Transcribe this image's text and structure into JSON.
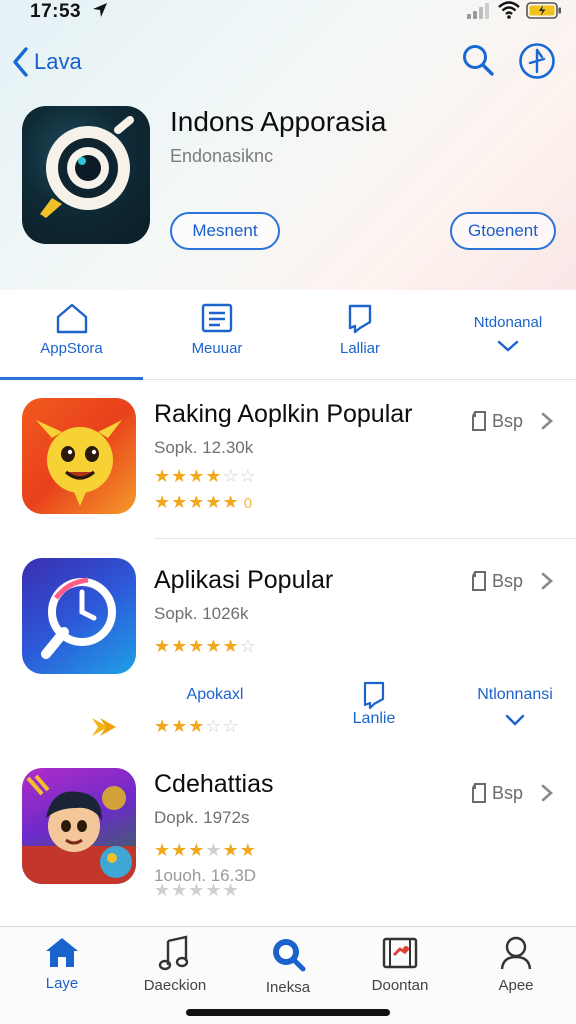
{
  "status_bar": {
    "time": "17:53"
  },
  "nav": {
    "back_label": "Lava"
  },
  "app": {
    "title": "Indons Apporasia",
    "subtitle": "Endonasiknc",
    "btn_left": "Mesnent",
    "btn_right": "Gtoenent"
  },
  "tabs": [
    {
      "label": "AppStora",
      "icon": "house-icon"
    },
    {
      "label": "Meuuar",
      "icon": "list-icon"
    },
    {
      "label": "Lalliar",
      "icon": "bookmark-icon"
    },
    {
      "label": "Ntdonanal",
      "icon": "chevron-down-icon"
    }
  ],
  "rows": [
    {
      "title": "Raking Aoplkin Popular",
      "meta": "Sopk. 12.30k",
      "rating": 3.5,
      "rating2": 5,
      "rating2_suffix": "0",
      "get_label": "Bsp"
    },
    {
      "title": "Aplikasi Popular",
      "meta": "Sopk. 1026k",
      "rating": 4.5,
      "get_label": "Bsp"
    },
    {
      "title": "Cdehattias",
      "meta": "Dopk. 1972s",
      "rating": 4,
      "meta2": "1ouoh. 16.3D",
      "get_label": "Bsp"
    }
  ],
  "subtabs": [
    {
      "label": "Apokaxl"
    },
    {
      "label": "Lanlie"
    },
    {
      "label": "Ntlonnansi"
    }
  ],
  "sub_rating": 3,
  "tabbar": [
    {
      "label": "Laye",
      "icon": "home-icon"
    },
    {
      "label": "Daeckion",
      "icon": "music-note-icon"
    },
    {
      "label": "Ineksa",
      "icon": "search-icon"
    },
    {
      "label": "Doontan",
      "icon": "update-icon"
    },
    {
      "label": "Apee",
      "icon": "person-icon"
    }
  ],
  "colors": {
    "accent": "#2a74d9",
    "star": "#f2a81c"
  }
}
